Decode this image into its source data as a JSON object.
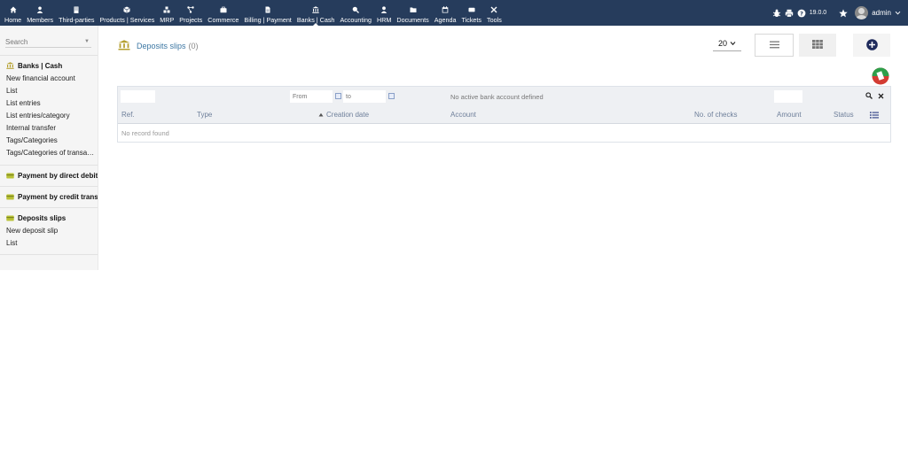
{
  "menu": [
    {
      "label": "Home",
      "icon": "home-icon",
      "active": false
    },
    {
      "label": "Members",
      "icon": "member-icon",
      "active": false
    },
    {
      "label": "Third-parties",
      "icon": "building-icon",
      "active": false
    },
    {
      "label": "Products | Services",
      "icon": "cube-icon",
      "active": false
    },
    {
      "label": "MRP",
      "icon": "cubes-icon",
      "active": false
    },
    {
      "label": "Projects",
      "icon": "project-icon",
      "active": false
    },
    {
      "label": "Commerce",
      "icon": "briefcase-icon",
      "active": false
    },
    {
      "label": "Billing | Payment",
      "icon": "invoice-icon",
      "active": false
    },
    {
      "label": "Banks | Cash",
      "icon": "bank-icon",
      "active": true
    },
    {
      "label": "Accounting",
      "icon": "search-dollar-icon",
      "active": false
    },
    {
      "label": "HRM",
      "icon": "user-icon",
      "active": false
    },
    {
      "label": "Documents",
      "icon": "folder-icon",
      "active": false
    },
    {
      "label": "Agenda",
      "icon": "calendar-icon",
      "active": false
    },
    {
      "label": "Tickets",
      "icon": "ticket-icon",
      "active": false
    },
    {
      "label": "Tools",
      "icon": "tools-icon",
      "active": false
    }
  ],
  "topright": {
    "version": "19.0.0",
    "username": "admin"
  },
  "sidebar": {
    "search_placeholder": "Search",
    "sections": [
      {
        "title": "Banks | Cash",
        "icon": "bank-icon",
        "links": [
          "New financial account",
          "List",
          "List entries",
          "List entries/category",
          "Internal transfer",
          "Tags/Categories",
          "Tags/Categories of transactions"
        ]
      },
      {
        "title": "Payment by direct debit",
        "icon": "card-icon",
        "links": []
      },
      {
        "title": "Payment by credit transfer",
        "icon": "card-icon",
        "links": []
      },
      {
        "title": "Deposits slips",
        "icon": "card-icon",
        "links": [
          "New deposit slip",
          "List"
        ]
      }
    ]
  },
  "page": {
    "title": "Deposits slips",
    "count": "(0)",
    "limit": "20"
  },
  "table": {
    "filters": {
      "date_from_placeholder": "From",
      "date_to_placeholder": "to",
      "account_note": "No active bank account defined"
    },
    "columns": [
      "Ref.",
      "Type",
      "Creation date",
      "Account",
      "No. of checks",
      "Amount",
      "Status"
    ],
    "sorted_column": "Creation date",
    "empty_text": "No record found"
  },
  "colors": {
    "topbar": "#263c5c",
    "link": "#3c77a3",
    "header_text": "#6e7f9a",
    "bank_icon": "#b5a030",
    "card_icon": "#b9c236"
  }
}
